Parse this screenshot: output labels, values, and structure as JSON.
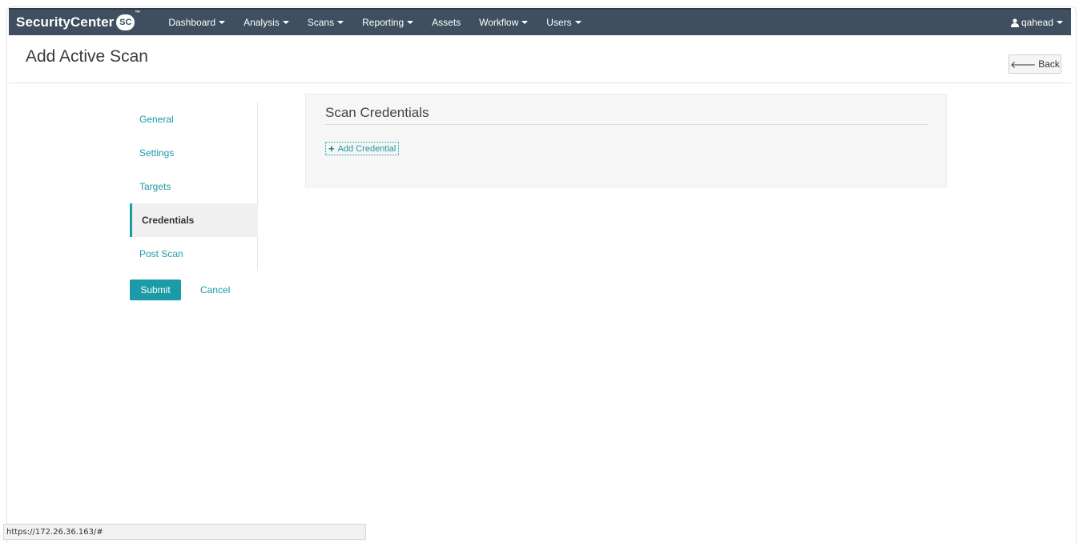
{
  "brand": {
    "name": "SecurityCenter",
    "badge": "SC"
  },
  "nav": {
    "items": [
      {
        "label": "Dashboard",
        "dropdown": true
      },
      {
        "label": "Analysis",
        "dropdown": true
      },
      {
        "label": "Scans",
        "dropdown": true
      },
      {
        "label": "Reporting",
        "dropdown": true
      },
      {
        "label": "Assets",
        "dropdown": false
      },
      {
        "label": "Workflow",
        "dropdown": true
      },
      {
        "label": "Users",
        "dropdown": true
      }
    ],
    "user": "qahead"
  },
  "page": {
    "title": "Add Active Scan",
    "back_label": "Back"
  },
  "steps": [
    {
      "label": "General"
    },
    {
      "label": "Settings"
    },
    {
      "label": "Targets"
    },
    {
      "label": "Credentials",
      "active": true
    },
    {
      "label": "Post Scan"
    }
  ],
  "actions": {
    "submit": "Submit",
    "cancel": "Cancel"
  },
  "panel": {
    "title": "Scan Credentials",
    "add_label": "Add Credential"
  },
  "status_bar": {
    "url": "https://172.26.36.163/#"
  },
  "colors": {
    "navbar": "#3f4f5f",
    "accent": "#1b9aa8"
  }
}
